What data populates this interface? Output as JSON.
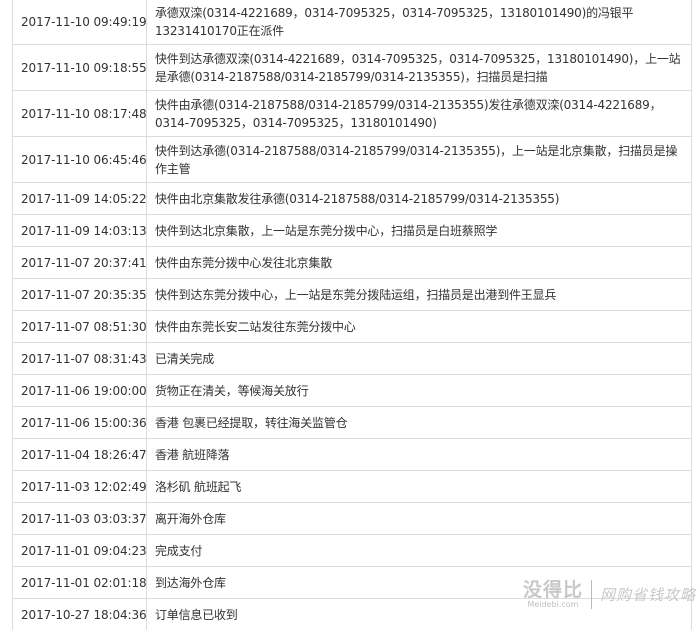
{
  "tracking": {
    "rows": [
      {
        "time": "2017-11-10 09:49:19",
        "desc": "承德双滦(0314-4221689，0314-7095325，0314-7095325，13180101490)的冯银平13231410170正在派件",
        "lines": 2
      },
      {
        "time": "2017-11-10 09:18:55",
        "desc": "快件到达承德双滦(0314-4221689，0314-7095325，0314-7095325，13180101490)，上一站是承德(0314-2187588/0314-2185799/0314-2135355)，扫描员是扫描",
        "lines": 2
      },
      {
        "time": "2017-11-10 08:17:48",
        "desc": "快件由承德(0314-2187588/0314-2185799/0314-2135355)发往承德双滦(0314-4221689，0314-7095325，0314-7095325，13180101490)",
        "lines": 2
      },
      {
        "time": "2017-11-10 06:45:46",
        "desc": "快件到达承德(0314-2187588/0314-2185799/0314-2135355)，上一站是北京集散，扫描员是操作主管",
        "lines": 2
      },
      {
        "time": "2017-11-09 14:05:22",
        "desc": "快件由北京集散发往承德(0314-2187588/0314-2185799/0314-2135355)",
        "lines": 1
      },
      {
        "time": "2017-11-09 14:03:13",
        "desc": "快件到达北京集散，上一站是东莞分拨中心，扫描员是白班蔡照学",
        "lines": 1
      },
      {
        "time": "2017-11-07 20:37:41",
        "desc": "快件由东莞分拨中心发往北京集散",
        "lines": 1
      },
      {
        "time": "2017-11-07 20:35:35",
        "desc": "快件到达东莞分拨中心，上一站是东莞分拨陆运组，扫描员是出港到件王显兵",
        "lines": 1
      },
      {
        "time": "2017-11-07 08:51:30",
        "desc": "快件由东莞长安二站发往东莞分拨中心",
        "lines": 1
      },
      {
        "time": "2017-11-07 08:31:43",
        "desc": "已清关完成",
        "lines": 1
      },
      {
        "time": "2017-11-06 19:00:00",
        "desc": "货物正在清关，等候海关放行",
        "lines": 1
      },
      {
        "time": "2017-11-06 15:00:36",
        "desc": "香港 包裹已经提取，转往海关监管仓",
        "lines": 1
      },
      {
        "time": "2017-11-04 18:26:47",
        "desc": "香港 航班降落",
        "lines": 1
      },
      {
        "time": "2017-11-03 12:02:49",
        "desc": "洛杉矶 航班起飞",
        "lines": 1
      },
      {
        "time": "2017-11-03 03:03:37",
        "desc": "离开海外仓库",
        "lines": 1
      },
      {
        "time": "2017-11-01 09:04:23",
        "desc": "完成支付",
        "lines": 1
      },
      {
        "time": "2017-11-01 02:01:18",
        "desc": "到达海外仓库",
        "lines": 1
      },
      {
        "time": "2017-10-27 18:04:36",
        "desc": "订单信息已收到",
        "lines": 1
      }
    ]
  },
  "watermark": {
    "logo": "没得比",
    "domain": "Meidebi.com",
    "slogan": "网购省钱攻略"
  }
}
